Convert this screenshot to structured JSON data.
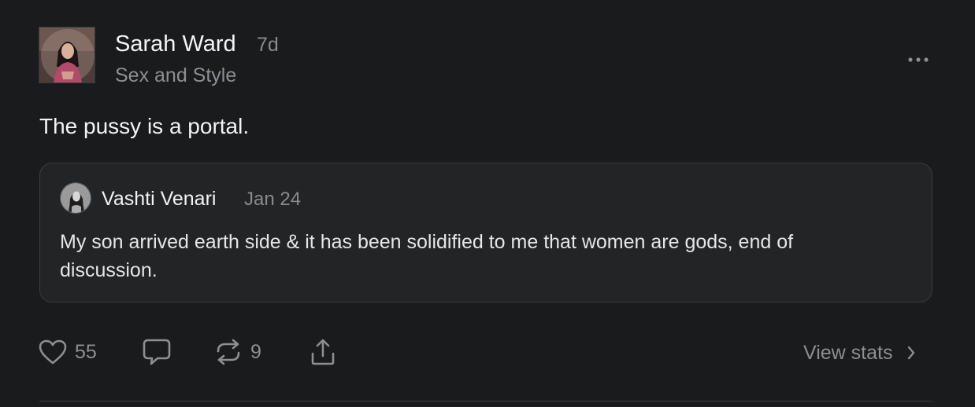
{
  "post": {
    "author": {
      "name": "Sarah Ward",
      "time": "7d",
      "publication": "Sex and Style",
      "avatar_icon": "author-avatar"
    },
    "more_icon": "more-horizontal-icon",
    "text": "The pussy is a portal.",
    "quote": {
      "author": "Vashti Venari",
      "time": "Jan 24",
      "text": "My son arrived earth side & it has been solidified to me that women are gods, end of discussion.",
      "avatar_icon": "quoted-author-avatar"
    },
    "actions": {
      "likes": "55",
      "restacks": "9",
      "view_stats_label": "View stats",
      "icons": [
        "heart-icon",
        "comment-icon",
        "restack-icon",
        "share-icon",
        "chevron-right-icon"
      ]
    }
  },
  "colors": {
    "background": "#1a1b1d",
    "card_background": "#232426",
    "text_primary": "#f2f2f2",
    "text_secondary": "#8e8e93",
    "border": "#3a3a3c"
  }
}
